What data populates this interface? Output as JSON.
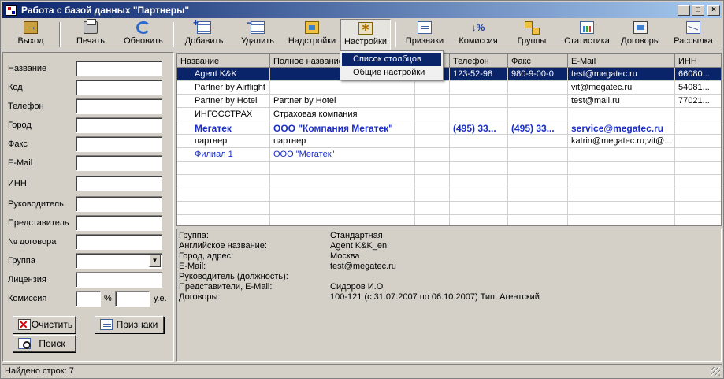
{
  "window": {
    "title": "Работа с базой данных \"Партнеры\""
  },
  "toolbar": [
    {
      "label": "Выход",
      "icon": "exit-icon"
    },
    {
      "label": "Печать",
      "icon": "print-icon"
    },
    {
      "label": "Обновить",
      "icon": "refresh-icon"
    },
    {
      "label": "Добавить",
      "icon": "add-icon"
    },
    {
      "label": "Удалить",
      "icon": "delete-icon"
    },
    {
      "label": "Надстройки",
      "icon": "addons-icon"
    },
    {
      "label": "Настройки",
      "icon": "settings-icon"
    },
    {
      "label": "Признаки",
      "icon": "tags-icon"
    },
    {
      "label": "Комиссия",
      "icon": "percent-icon"
    },
    {
      "label": "Группы",
      "icon": "groups-icon"
    },
    {
      "label": "Статистика",
      "icon": "stats-icon"
    },
    {
      "label": "Договоры",
      "icon": "contracts-icon"
    },
    {
      "label": "Рассылка",
      "icon": "mail-icon"
    }
  ],
  "settings_menu": [
    "Список столбцов",
    "Общие настройки"
  ],
  "filter": {
    "fields": [
      "Название",
      "Код",
      "Телефон",
      "Город",
      "Факс",
      "E-Mail",
      "ИНН",
      "Руководитель",
      "Представитель",
      "№ договора",
      "Группа",
      "Лицензия",
      "Комиссия"
    ],
    "percent_sign": "%",
    "currency_unit": "у.е.",
    "clear_button": "Очистить",
    "tags_button": "Признаки",
    "search_button": "Поиск"
  },
  "grid": {
    "columns": [
      "Название",
      "Полное название",
      "",
      "Телефон",
      "Факс",
      "E-Mail",
      "ИНН"
    ],
    "rows": [
      [
        "Agent K&K",
        "",
        "",
        "123-52-98",
        "980-9-00-0",
        "test@megatec.ru",
        "66080..."
      ],
      [
        "Partner by Airflight",
        "",
        "",
        "",
        "",
        "vit@megatec.ru",
        "54081..."
      ],
      [
        "Partner by Hotel",
        "Partner by Hotel",
        "",
        "",
        "",
        "test@mail.ru",
        "77021..."
      ],
      [
        "ИНГОССТРАХ",
        "Страховая компания",
        "",
        "",
        "",
        "",
        ""
      ],
      [
        "Мегатек",
        "ООО \"Компания Мегатек\"",
        "",
        "(495) 33...",
        "(495) 33...",
        "service@megatec.ru",
        ""
      ],
      [
        "партнер",
        "партнер",
        "",
        "",
        "",
        "katrin@megatec.ru;vit@...",
        ""
      ],
      [
        "Филиал 1",
        "ООО \"Мегатек\"",
        "",
        "",
        "",
        "",
        ""
      ]
    ]
  },
  "details": [
    [
      "Группа:",
      "Стандартная"
    ],
    [
      "Английское название:",
      "Agent K&K_en"
    ],
    [
      "Город, адрес:",
      "Москва"
    ],
    [
      "E-Mail:",
      "test@megatec.ru"
    ],
    [
      "Руководитель (должность):",
      ""
    ],
    [
      "Представители, E-Mail:",
      "Сидоров И.О"
    ],
    [
      "Договоры:",
      "100-121 (с 31.07.2007 по 06.10.2007) Тип: Агентский"
    ]
  ],
  "status": "Найдено строк: 7"
}
